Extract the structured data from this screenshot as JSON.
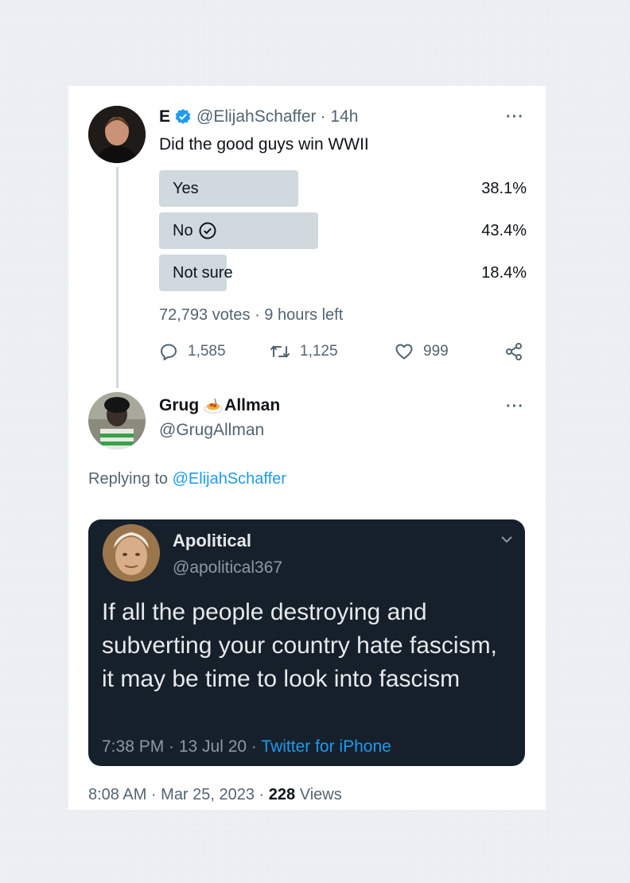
{
  "tweet": {
    "author_name": "E",
    "author_handle": "@ElijahSchaffer",
    "time_ago": "· 14h",
    "text": "Did the good guys win WWII",
    "poll": {
      "options": [
        {
          "label": "Yes",
          "percent_text": "38.1%",
          "percent": 38.1
        },
        {
          "label": "No",
          "percent_text": "43.4%",
          "percent": 43.4
        },
        {
          "label": "Not sure",
          "percent_text": "18.4%",
          "percent": 18.4
        }
      ],
      "meta": "72,793 votes · 9 hours left"
    },
    "actions": {
      "replies": "1,585",
      "retweets": "1,125",
      "likes": "999"
    }
  },
  "reply": {
    "author_name_first": "Grug",
    "author_name_last": "Allman",
    "author_handle": "@GrugAllman",
    "replying_prefix": "Replying to",
    "replying_handle": "@ElijahSchaffer",
    "quote": {
      "name": "Apolitical",
      "handle": "@apolitical367",
      "text": "If all the people destroying and subverting your country hate fascism, it may be time to look into fascism",
      "time": "7:38 PM · 13 Jul 20 ·",
      "source": "Twitter for iPhone"
    },
    "footer": {
      "timestamp": "8:08 AM · Mar 25, 2023 ·",
      "views_count": "228",
      "views_label": "Views"
    }
  },
  "colors": {
    "accent": "#1d9bf0",
    "poll_bar": "#cfd9de",
    "quote_bg": "#15202b"
  }
}
